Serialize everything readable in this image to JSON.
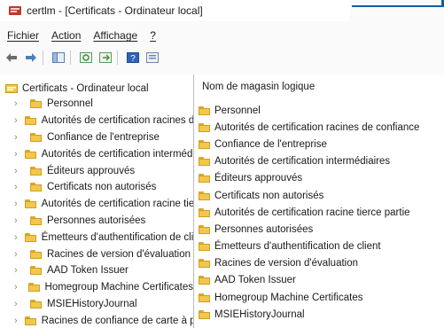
{
  "window": {
    "title": "certlm - [Certificats - Ordinateur local]"
  },
  "menu": {
    "items": [
      "Fichier",
      "Action",
      "Affichage",
      "?"
    ]
  },
  "toolbar": {
    "buttons": [
      "back-arrow-icon",
      "forward-arrow-icon",
      "show-hide-tree-icon",
      "refresh-icon",
      "export-list-icon",
      "help-icon",
      "properties-icon"
    ]
  },
  "tree": {
    "root_label": "Certificats - Ordinateur local",
    "items": [
      "Personnel",
      "Autorités de certification racines de confiance",
      "Confiance de l'entreprise",
      "Autorités de certification intermédiaires",
      "Éditeurs approuvés",
      "Certificats non autorisés",
      "Autorités de certification racine tierce partie",
      "Personnes autorisées",
      "Émetteurs d'authentification de client",
      "Racines de version d'évaluation",
      "AAD Token Issuer",
      "Homegroup Machine Certificates",
      "MSIEHistoryJournal",
      "Racines de confiance de carte à puce"
    ]
  },
  "list": {
    "column_header": "Nom de magasin logique",
    "items": [
      "Personnel",
      "Autorités de certification racines de confiance",
      "Confiance de l'entreprise",
      "Autorités de certification intermédiaires",
      "Éditeurs approuvés",
      "Certificats non autorisés",
      "Autorités de certification racine tierce partie",
      "Personnes autorisées",
      "Émetteurs d'authentification de client",
      "Racines de version d'évaluation",
      "AAD Token Issuer",
      "Homegroup Machine Certificates",
      "MSIEHistoryJournal"
    ]
  },
  "colors": {
    "accent": "#0e5fa8",
    "folder": "#f1c84b"
  }
}
